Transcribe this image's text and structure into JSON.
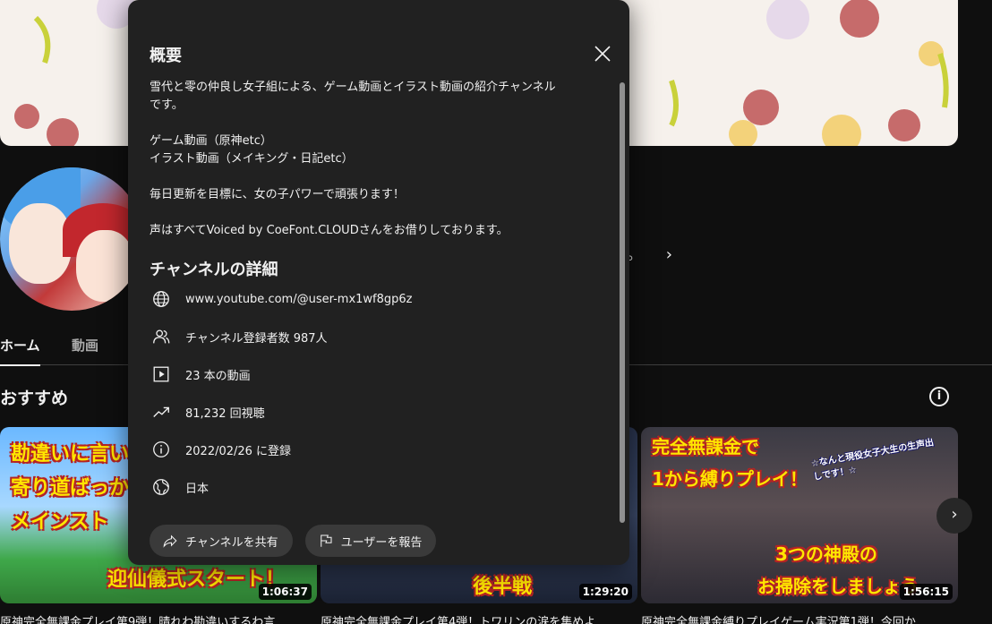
{
  "modal": {
    "title": "概要",
    "description": [
      "雪代と零の仲良し女子組による、ゲーム動画とイラスト動画の紹介チャンネル",
      "です。",
      "",
      "ゲーム動画（原神etc）",
      "イラスト動画（メイキング・日記etc）",
      "",
      "毎日更新を目標に、女の子パワーで頑張ります！",
      "",
      "声はすべてVoiced by CoeFont.CLOUDさんをお借りしております。"
    ],
    "details_title": "チャンネルの詳細",
    "details": {
      "url": "www.youtube.com/@user-mx1wf8gp6z",
      "subscribers": "チャンネル登録者数 987人",
      "videos": "23 本の動画",
      "views": "81,232 回視聴",
      "joined": "2022/02/26 に登録",
      "country": "日本"
    },
    "share_label": "チャンネルを共有",
    "report_label": "ユーザーを報告"
  },
  "channel": {
    "more_text": "。",
    "tabs": [
      "ホーム",
      "動画"
    ],
    "section_title": "おすすめ"
  },
  "videos": [
    {
      "title": "原神完全無課金プレイ第9弾！晴れわ勘違いするわ言",
      "duration": "1:06:37",
      "overlay": [
        "勘違いに言い",
        "寄り道ばっか",
        "メインスト",
        "迎仙儀式スタート！"
      ]
    },
    {
      "title": "原神完全無課金プレイ第4弾！トワリンの涙を集めよ",
      "duration": "1:29:20",
      "overlay": [
        "後半戦"
      ]
    },
    {
      "title": "原神完全無課金縛りプレイゲーム実況第1弾！今回か",
      "duration": "1:56:15",
      "overlay": [
        "完全無課金で",
        "1から縛りプレイ！",
        "☆なんと現役女子大生の生声出しです！☆",
        "3つの神殿の",
        "お掃除をしましょう"
      ]
    }
  ],
  "colors": {
    "background": "#0f0f0f",
    "modal": "#212121",
    "pill": "#3a3a3a",
    "text": "#f1f1f1"
  }
}
